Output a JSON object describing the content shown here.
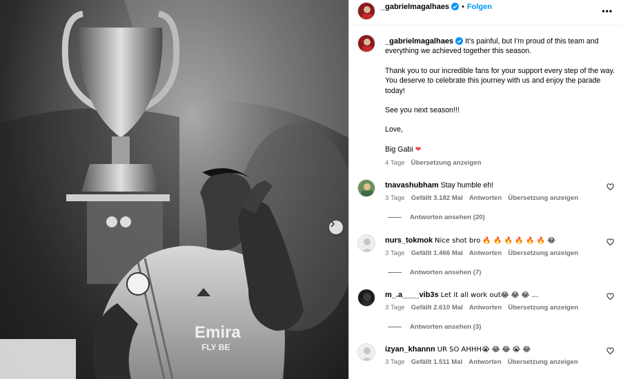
{
  "post": {
    "author": "_gabrielmagalhaes",
    "follow_label": "Folgen",
    "more_label": "•••",
    "caption_lines": [
      "It’s painful, but I’m proud of this team and everything we achieved together this season.",
      "Thank you to our incredible fans for your support every step of the way. You deserve to celebrate this journey with us and enjoy the parade today!",
      "See you next season!!!",
      "Love,",
      "Big Gabi ❤"
    ],
    "time": "4 Tage",
    "translate_label": "Übersetzung anzeigen"
  },
  "media": {
    "kit_sponsor": "Emira",
    "kit_sponsor_line2": "FLY BE"
  },
  "comments": [
    {
      "user": "tnavashubham",
      "text": "Stay humble eh!",
      "time": "3 Tage",
      "likes": "Gefällt 3.182 Mal",
      "reply_label": "Antworten",
      "translate_label": "Übersetzung anzeigen",
      "view_replies": "Antworten ansehen (20)"
    },
    {
      "user": "nurs_tokmok",
      "text": "Nice shot bro 🔥 🔥 🔥 🔥 🔥 🔥 😂",
      "time": "3 Tage",
      "likes": "Gefällt 1.466 Mal",
      "reply_label": "Antworten",
      "translate_label": "Übersetzung anzeigen",
      "view_replies": "Antworten ansehen (7)"
    },
    {
      "user": "m_.a____vib3s",
      "text": "Let it all work out😂 😂 😂 ...",
      "time": "3 Tage",
      "likes": "Gefällt 2.610 Mal",
      "reply_label": "Antworten",
      "translate_label": "Übersetzung anzeigen",
      "view_replies": "Antworten ansehen (3)"
    },
    {
      "user": "izyan_khannn",
      "text": "UR SO AHHH😭 😂 😂 😭 😂",
      "time": "3 Tage",
      "likes": "Gefällt 1.511 Mal",
      "reply_label": "Antworten",
      "translate_label": "Übersetzung anzeigen",
      "view_replies": ""
    }
  ],
  "colors": {
    "accent": "#0095f6",
    "verified": "#0095f6",
    "heart_red": "#ed4956",
    "muted": "#737373"
  },
  "icons": {
    "verified": "verified-badge-icon",
    "like": "heart-outline-icon",
    "carousel": "chevron-right-icon",
    "more": "more-options-icon"
  }
}
